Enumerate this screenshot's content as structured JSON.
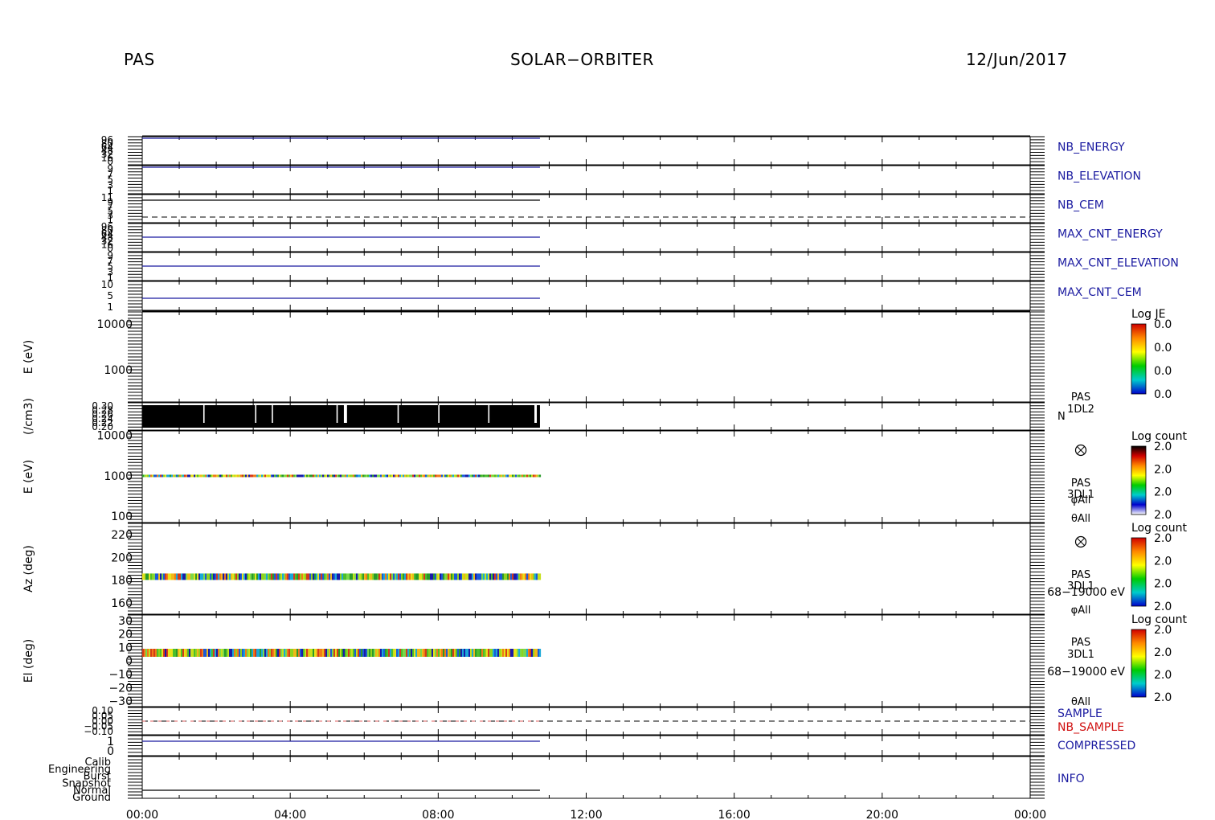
{
  "header": {
    "instrument": "PAS",
    "mission": "SOLAR−ORBITER",
    "date": "12/Jun/2017"
  },
  "colors": {
    "frame": "#000000",
    "trace_blue": "#1a1aa0",
    "label_blue": "#1a1aa0",
    "label_red": "#d01010",
    "series_red": "#e06060"
  },
  "chart_data": [
    {
      "id": "nb-energy",
      "type": "line",
      "ylabel_right": "NB_ENERGY",
      "tick_labels": [
        "96",
        "80",
        "64",
        "48",
        "32",
        "16",
        "0"
      ],
      "x_range_hours": [
        0,
        24
      ],
      "series": [
        {
          "name": "NB_ENERGY",
          "x_hours": [
            0,
            10.75
          ],
          "values": [
            96,
            96
          ]
        }
      ]
    },
    {
      "id": "nb-elevation",
      "type": "line",
      "ylabel_right": "NB_ELEVATION",
      "tick_labels": [
        "9",
        "7",
        "5",
        "3",
        "1"
      ],
      "x_range_hours": [
        0,
        24
      ],
      "series": [
        {
          "name": "NB_ELEVATION",
          "x_hours": [
            0,
            10.75
          ],
          "values": [
            9,
            9
          ]
        }
      ]
    },
    {
      "id": "nb-cem",
      "type": "line",
      "ylabel_right": "NB_CEM",
      "tick_labels": [
        "11",
        "9",
        "7",
        "5",
        "3",
        "1"
      ],
      "x_range_hours": [
        0,
        24
      ],
      "series": [
        {
          "name": "NB_CEM",
          "x_hours": [
            0,
            10.75
          ],
          "values": [
            11,
            11
          ]
        }
      ],
      "dashed_reference_line": true
    },
    {
      "id": "max-cnt-energy",
      "type": "line",
      "ylabel_right": "MAX_CNT_ENERGY",
      "tick_labels": [
        "96",
        "80",
        "64",
        "48",
        "32",
        "16",
        "0"
      ],
      "x_range_hours": [
        0,
        24
      ],
      "series": [
        {
          "name": "MAX_CNT_ENERGY",
          "x_hours": [
            0,
            10.75
          ],
          "values": [
            48,
            48
          ]
        }
      ]
    },
    {
      "id": "max-cnt-elevation",
      "type": "line",
      "ylabel_right": "MAX_CNT_ELEVATION",
      "tick_labels": [
        "9",
        "7",
        "5",
        "3",
        "1"
      ],
      "x_range_hours": [
        0,
        24
      ],
      "series": [
        {
          "name": "MAX_CNT_ELEVATION",
          "x_hours": [
            0,
            10.75
          ],
          "values": [
            5,
            5
          ]
        }
      ]
    },
    {
      "id": "max-cnt-cem",
      "type": "line",
      "ylabel_right": "MAX_CNT_CEM",
      "tick_labels": [
        "10",
        "5",
        "1"
      ],
      "x_range_hours": [
        0,
        24
      ],
      "series": [
        {
          "name": "MAX_CNT_CEM",
          "x_hours": [
            0,
            10.75
          ],
          "values": [
            3,
            3
          ]
        }
      ]
    },
    {
      "id": "je-spectrogram",
      "type": "heatmap",
      "ylabel": "E (eV)",
      "yscale": "log",
      "y_tick_labels": [
        "10000",
        "1000"
      ],
      "colorbar": {
        "title": "Log JE",
        "tick_labels": [
          "0.0",
          "0.0",
          "0.0",
          "0.0"
        ]
      },
      "data": "empty"
    },
    {
      "id": "density",
      "type": "line",
      "ylabel": "(/cm3)",
      "tick_labels": [
        "0.30",
        "0.28",
        "0.26",
        "0.24",
        "0.22",
        "0.20"
      ],
      "annotations": [
        "PAS",
        "1DL2",
        "N"
      ],
      "x_range_hours": [
        0,
        24
      ],
      "coverage_hours": [
        0,
        10.75
      ],
      "gap_hours": [
        1.65,
        3.05,
        3.5,
        5.25,
        5.45,
        5.48,
        5.5,
        6.9,
        8.0,
        9.35,
        10.6,
        10.63
      ],
      "note": "dense oscillation between 0.20 and 0.30"
    },
    {
      "id": "energy-spectrogram",
      "type": "heatmap",
      "ylabel": "E (eV)",
      "yscale": "log",
      "ylim": [
        70,
        13000
      ],
      "y_ticks": [
        10000,
        1000,
        100
      ],
      "band_value": 1000,
      "coverage_hours": [
        0,
        10.75
      ],
      "colorbar": {
        "title": "Log count",
        "tick_labels": [
          "2.0",
          "2.0",
          "2.0",
          "2.0"
        ]
      },
      "annotations": [
        "PAS",
        "3DL1",
        "φAll",
        "θAll"
      ],
      "icon": "circled-x-icon"
    },
    {
      "id": "azimuth-spectrogram",
      "type": "heatmap",
      "ylabel": "Az (deg)",
      "ylim": [
        150,
        230
      ],
      "y_ticks": [
        220,
        200,
        180,
        160
      ],
      "band_value": 183,
      "coverage_hours": [
        0,
        10.75
      ],
      "colorbar": {
        "title": "Log count",
        "tick_labels": [
          "2.0",
          "2.0",
          "2.0",
          "2.0"
        ]
      },
      "annotations": [
        "PAS",
        "3DL1",
        "68−19000 eV",
        "φAll"
      ],
      "icon": "circled-x-icon"
    },
    {
      "id": "elevation-spectrogram",
      "type": "heatmap",
      "ylabel": "El (deg)",
      "ylim": [
        -30,
        30
      ],
      "y_ticks": [
        30,
        20,
        10,
        0,
        -10,
        -20,
        -30
      ],
      "y_tick_labels": [
        "30",
        "20",
        "10",
        "0",
        "−10",
        "−20",
        "−30"
      ],
      "band_value": 6,
      "coverage_hours": [
        0,
        10.75
      ],
      "colorbar": {
        "title": "Log count",
        "tick_labels": [
          "2.0",
          "2.0",
          "2.0",
          "2.0"
        ]
      },
      "annotations": [
        "PAS",
        "3DL1",
        "68−19000 eV",
        "θAll"
      ]
    },
    {
      "id": "sample",
      "type": "line",
      "tick_labels": [
        "0.10",
        "0.05",
        "0.00",
        "−0.05",
        "−0.10"
      ],
      "x_range_hours": [
        0,
        24
      ],
      "series": [
        {
          "name": "SAMPLE",
          "x_hours": [
            0,
            24
          ],
          "values": [
            0,
            0
          ]
        },
        {
          "name": "NB_SAMPLE",
          "x_hours": [
            0,
            10.75
          ],
          "values": [
            0,
            0
          ]
        }
      ]
    },
    {
      "id": "compressed",
      "type": "line",
      "ylabel_right": "COMPRESSED",
      "tick_labels": [
        "1",
        "0"
      ],
      "x_range_hours": [
        0,
        24
      ],
      "series": [
        {
          "name": "COMPRESSED",
          "x_hours": [
            0,
            10.75
          ],
          "values": [
            1,
            1
          ]
        }
      ]
    },
    {
      "id": "info",
      "type": "line",
      "ylabel_right": "INFO",
      "tick_labels": [
        "Calib",
        "Engineering",
        "Burst",
        "Snapshot",
        "Normal",
        "Ground"
      ],
      "x_range_hours": [
        0,
        24
      ],
      "series": [
        {
          "name": "INFO",
          "x_hours": [
            0,
            10.75
          ],
          "values": [
            "Normal",
            "Normal"
          ]
        }
      ]
    }
  ],
  "x_axis": {
    "range_hours": [
      0,
      24
    ],
    "tick_labels": [
      "00:00",
      "04:00",
      "08:00",
      "12:00",
      "16:00",
      "20:00",
      "00:00"
    ]
  }
}
